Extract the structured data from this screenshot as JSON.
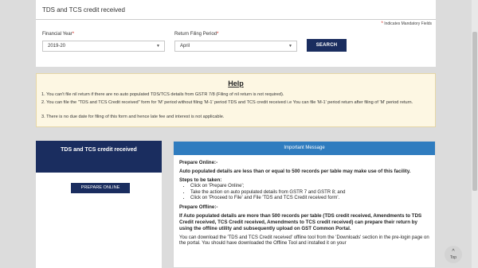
{
  "form_card": {
    "title": "TDS and TCS credit received",
    "mandatory_note": "Indicates Mandatory Fields",
    "financial_year_label": "Financial Year",
    "financial_year_value": "2019-20",
    "return_period_label": "Return Filing Period",
    "return_period_value": "April",
    "search_label": "SEARCH",
    "required_marker": "*"
  },
  "help": {
    "title": "Help",
    "items": [
      "1. You can't file nil return if there are no auto populated TDS/TCS details from GSTR 7/8 (Filing of nil return is not required).",
      "2. You can file the \"TDS and TCS Credit received\" form for 'M' period without filing 'M-1' period TDS and TCS credit received i.e You can file 'M-1' period return after filing of 'M' period return.",
      "3. There is no due date for filing of this form and hence late fee and interest is not applicable."
    ]
  },
  "left_panel": {
    "heading": "TDS and TCS credit received",
    "prepare_online_label": "PREPARE ONLINE"
  },
  "important_message": {
    "heading": "Important Message",
    "prepare_online_title": "Prepare Online:-",
    "online_threshold": "Auto populated details are less than or equal to 500 records per table may make use of this facility.",
    "steps_title": "Steps to be taken:",
    "steps": [
      "Click on 'Prepare Online';",
      "Take the action on auto populated details from GSTR 7 and GSTR 8; and",
      "Click on 'Proceed to File' and File 'TDS and TCS Credit received form'."
    ],
    "prepare_offline_title": "Prepare Offline:-",
    "offline_threshold": "If Auto populated details are more than 500 records per table (TDS credit received, Amendments to TDS Credit received, TCS Credit received, Amendments to TCS credit received) can prepare their return by using the offline utility and subsequently upload on GST Common Portal.",
    "offline_download": "You can download the 'TDS and TCS Credit received' offline tool from the 'Downloads' section in the pre-login page on the portal. You should have downloaded the Offline Tool and installed it on your"
  },
  "scroll_top": {
    "arrow": "^",
    "label": "Top"
  }
}
